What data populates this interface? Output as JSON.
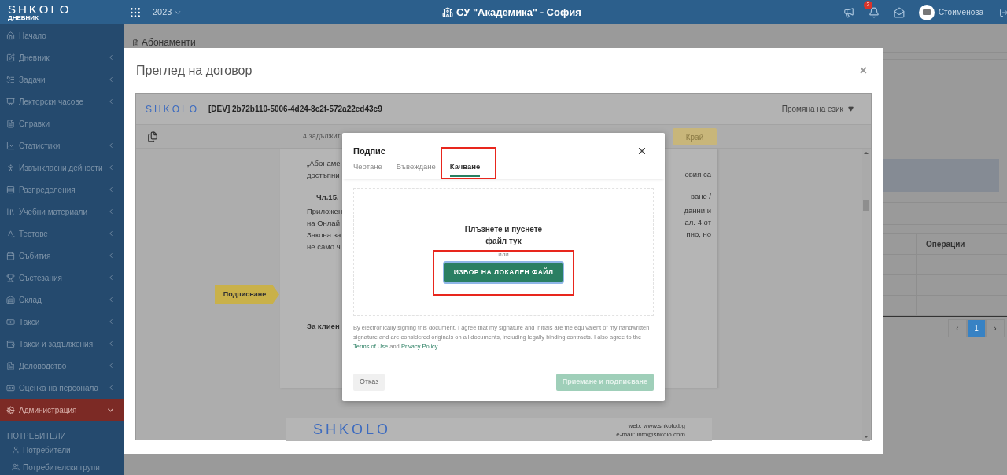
{
  "header": {
    "logo": "SHKOLO",
    "logo_subtitle": "ДНЕВНИК",
    "year": "2023",
    "school": "СУ \"Академика\" - София",
    "notifications_badge": "2",
    "user": "Стоименова"
  },
  "sidebar": {
    "items": [
      {
        "label": "Начало",
        "expandable": false,
        "selected": false
      },
      {
        "label": "Дневник",
        "expandable": true,
        "expanded": false,
        "selected": false
      },
      {
        "label": "Задачи",
        "expandable": true,
        "expanded": false,
        "selected": false
      },
      {
        "label": "Лекторски часове",
        "expandable": true,
        "expanded": false,
        "selected": false
      },
      {
        "label": "Справки",
        "expandable": false,
        "selected": false
      },
      {
        "label": "Статистики",
        "expandable": true,
        "expanded": false,
        "selected": false
      },
      {
        "label": "Извънкласни дейности",
        "expandable": true,
        "expanded": false,
        "selected": false
      },
      {
        "label": "Разпределения",
        "expandable": true,
        "expanded": false,
        "selected": false
      },
      {
        "label": "Учебни материали",
        "expandable": true,
        "expanded": false,
        "selected": false
      },
      {
        "label": "Тестове",
        "expandable": true,
        "expanded": false,
        "selected": false
      },
      {
        "label": "Събития",
        "expandable": true,
        "expanded": false,
        "selected": false
      },
      {
        "label": "Състезания",
        "expandable": true,
        "expanded": false,
        "selected": false
      },
      {
        "label": "Склад",
        "expandable": true,
        "expanded": false,
        "selected": false
      },
      {
        "label": "Такси",
        "expandable": true,
        "expanded": false,
        "selected": false
      },
      {
        "label": "Такси и задължения",
        "expandable": true,
        "expanded": false,
        "selected": false
      },
      {
        "label": "Деловодство",
        "expandable": true,
        "expanded": false,
        "selected": false
      },
      {
        "label": "Оценка на персонала",
        "expandable": true,
        "expanded": false,
        "selected": false
      },
      {
        "label": "Администрация",
        "expandable": true,
        "expanded": true,
        "selected": true
      }
    ],
    "section_heading": "ПОТРЕБИТЕЛИ",
    "sub_items": [
      {
        "label": "Потребители",
        "selected": false
      },
      {
        "label": "Потребителски групи",
        "selected": false
      }
    ]
  },
  "page": {
    "title": "Абонаменти",
    "table_column": "Операции",
    "pagination": [
      {
        "label": "‹",
        "selected": false
      },
      {
        "label": "1",
        "selected": true
      },
      {
        "label": "›",
        "selected": false
      }
    ]
  },
  "contract_modal": {
    "title": "Преглед на договор",
    "close": "×",
    "viewer": {
      "logo": "SHKOLO",
      "document_id": "[DEV] 2b72b110-5006-4d24-8c2f-572a22ed43c9",
      "language_menu": "Промяна на език",
      "required_fields": "4 задължит",
      "finish_button": "Край",
      "sign_tag": "Подписване",
      "left_fragments": [
        {
          "text": "„Абонаме",
          "bold": false
        },
        {
          "text": "достъпни",
          "bold": false
        },
        {
          "text": "Чл.15.",
          "bold": true
        },
        {
          "text": "Приложен",
          "bold": false
        },
        {
          "text": "на Онлай",
          "bold": false
        },
        {
          "text": "Закона за",
          "bold": false
        },
        {
          "text": "не само ч",
          "bold": false
        }
      ],
      "right_fragments": [
        "овия са",
        "ване /",
        "данни и",
        "ал. 4 от",
        "пно, но"
      ],
      "client_label": "За клиен",
      "footer_logo": "SHKOLO",
      "footer_web": "web: www.shkolo.bg",
      "footer_email": "e-mail: info@shkolo.com"
    }
  },
  "signature_dialog": {
    "title": "Подпис",
    "tabs": [
      {
        "label": "Чертане",
        "selected": false
      },
      {
        "label": "Въвеждане",
        "selected": false
      },
      {
        "label": "Качване",
        "selected": true
      }
    ],
    "drop_text_1": "Плъзнете и пуснете",
    "drop_text_2": "файл тук",
    "or": "или",
    "choose_button": "ИЗБОР НА ЛОКАЛЕН ФАЙЛ",
    "legal_before": "By electronically signing this document, I agree that my signature and initials are the equivalent of my handwritten signature and are considered originals on all documents, including legally binding contracts. I also agree to the",
    "terms_link": "Terms of Use",
    "and": "and",
    "privacy_link": "Privacy Policy",
    "legal_end": ".",
    "cancel_button": "Отказ",
    "accept_button": {
      "label": "Приемане и подписване",
      "disabled": true
    }
  }
}
